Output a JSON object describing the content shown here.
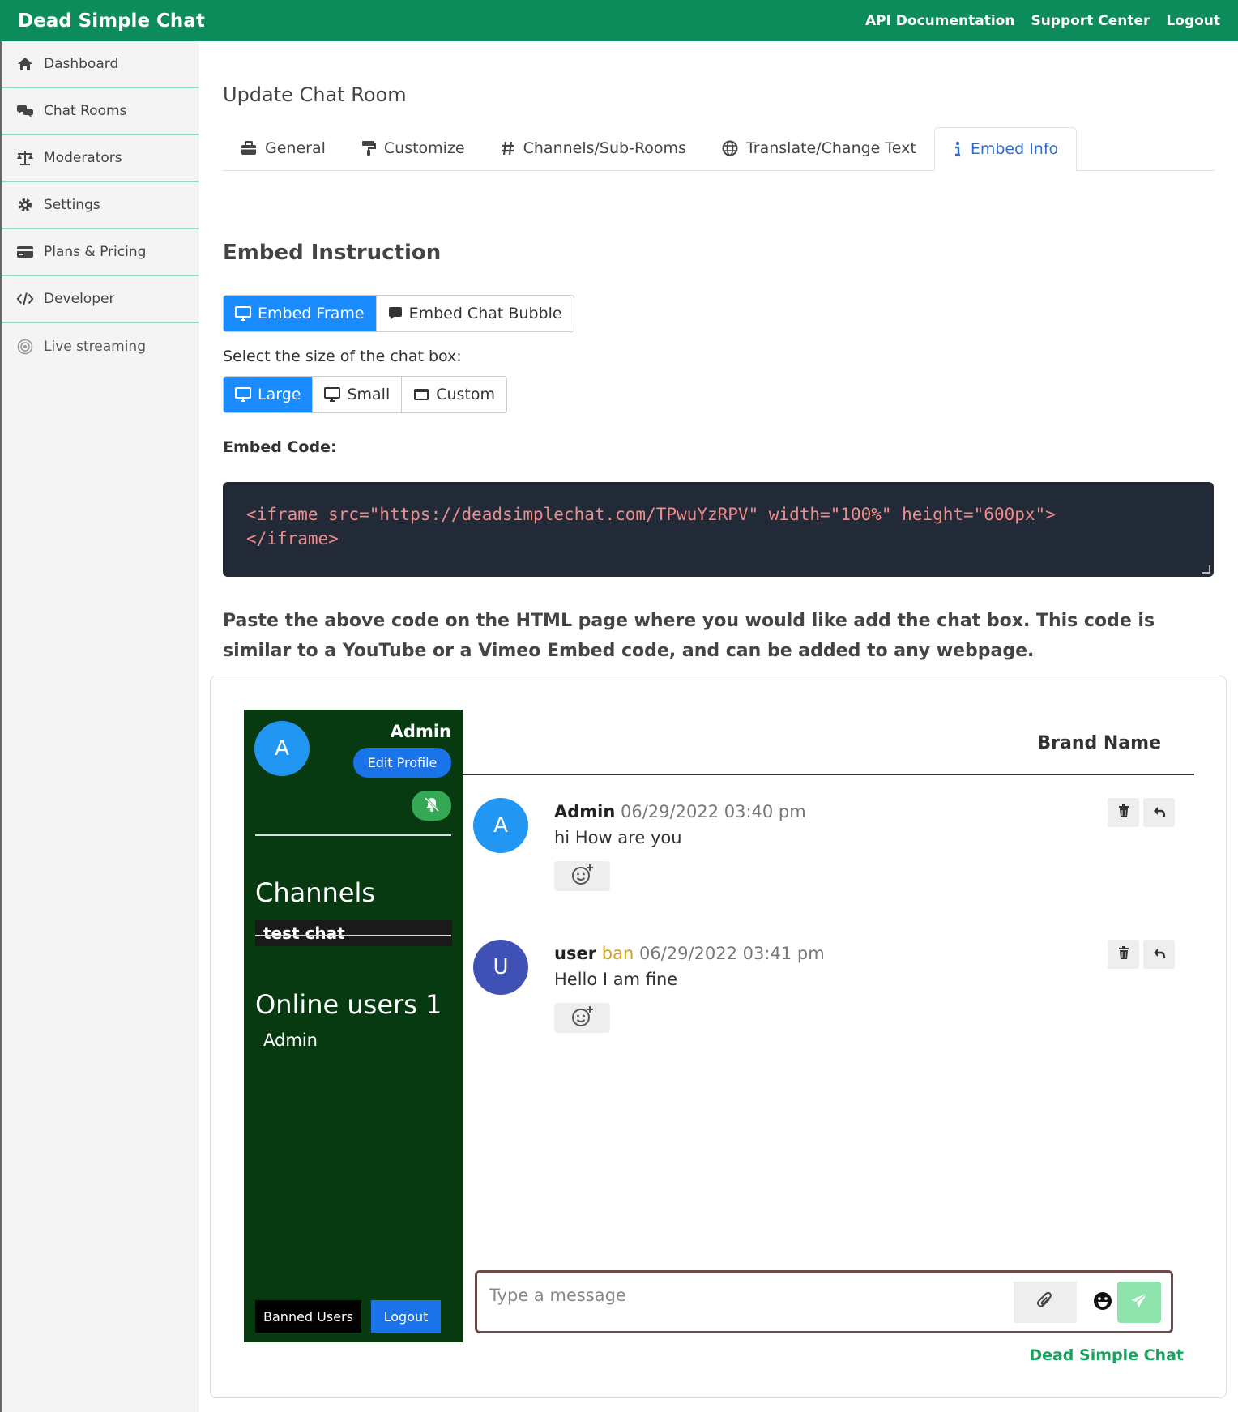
{
  "header": {
    "brand": "Dead Simple Chat",
    "links": [
      "API Documentation",
      "Support Center",
      "Logout"
    ]
  },
  "sidebar": {
    "items": [
      {
        "label": "Dashboard",
        "icon": "home-icon"
      },
      {
        "label": "Chat Rooms",
        "icon": "comments-icon"
      },
      {
        "label": "Moderators",
        "icon": "balance-scale-icon"
      },
      {
        "label": "Settings",
        "icon": "gear-icon"
      },
      {
        "label": "Plans & Pricing",
        "icon": "credit-card-icon"
      },
      {
        "label": "Developer",
        "icon": "code-icon"
      },
      {
        "label": "Live streaming",
        "icon": "broadcast-icon"
      }
    ]
  },
  "main": {
    "title": "Update Chat Room",
    "tabs": [
      {
        "label": "General",
        "icon": "briefcase-icon"
      },
      {
        "label": "Customize",
        "icon": "paint-roller-icon"
      },
      {
        "label": "Channels/Sub-Rooms",
        "icon": "hashtag-icon"
      },
      {
        "label": "Translate/Change Text",
        "icon": "globe-icon"
      },
      {
        "label": "Embed Info",
        "icon": "info-icon",
        "active": true
      }
    ],
    "embed_heading": "Embed Instruction",
    "embed_types": [
      {
        "label": "Embed Frame",
        "icon": "desktop-icon",
        "selected": true
      },
      {
        "label": "Embed Chat Bubble",
        "icon": "comment-icon",
        "selected": false
      }
    ],
    "size_label": "Select the size of the chat box:",
    "sizes": [
      {
        "label": "Large",
        "icon": "desktop-icon",
        "selected": true
      },
      {
        "label": "Small",
        "icon": "desktop-icon",
        "selected": false
      },
      {
        "label": "Custom",
        "icon": "window-icon",
        "selected": false
      }
    ],
    "code_label": "Embed Code:",
    "code_line1": "<iframe src=\"https://deadsimplechat.com/TPwuYzRPV\" width=\"100%\" height=\"600px\">",
    "code_line2": "</iframe>",
    "paste_text": "Paste the above code on the HTML page where you would like add the chat box. This code is similar to a YouTube or a Vimeo Embed code, and can be added to any webpage."
  },
  "preview": {
    "sidebar": {
      "avatar_letter": "A",
      "username": "Admin",
      "edit_profile": "Edit Profile",
      "channels_title": "Channels",
      "channels": [
        "test chat"
      ],
      "online_title": "Online users 1",
      "online_users": [
        "Admin"
      ],
      "banned_button": "Banned Users",
      "logout_button": "Logout"
    },
    "brand_name": "Brand Name",
    "messages": [
      {
        "avatar": "A",
        "avatar_color": "#2196f3",
        "author": "Admin",
        "ban": "",
        "time": "06/29/2022 03:40 pm",
        "text": "hi How are you"
      },
      {
        "avatar": "U",
        "avatar_color": "#3f51b5",
        "author": "user",
        "ban": "ban",
        "time": "06/29/2022 03:41 pm",
        "text": "Hello I am fine"
      }
    ],
    "input_placeholder": "Type a message",
    "powered_by": "Dead Simple Chat"
  },
  "colors": {
    "topbar": "#0c8c5a",
    "primary": "#1a8cff",
    "chat_sidebar": "#073a10",
    "powered": "#1aa260"
  }
}
